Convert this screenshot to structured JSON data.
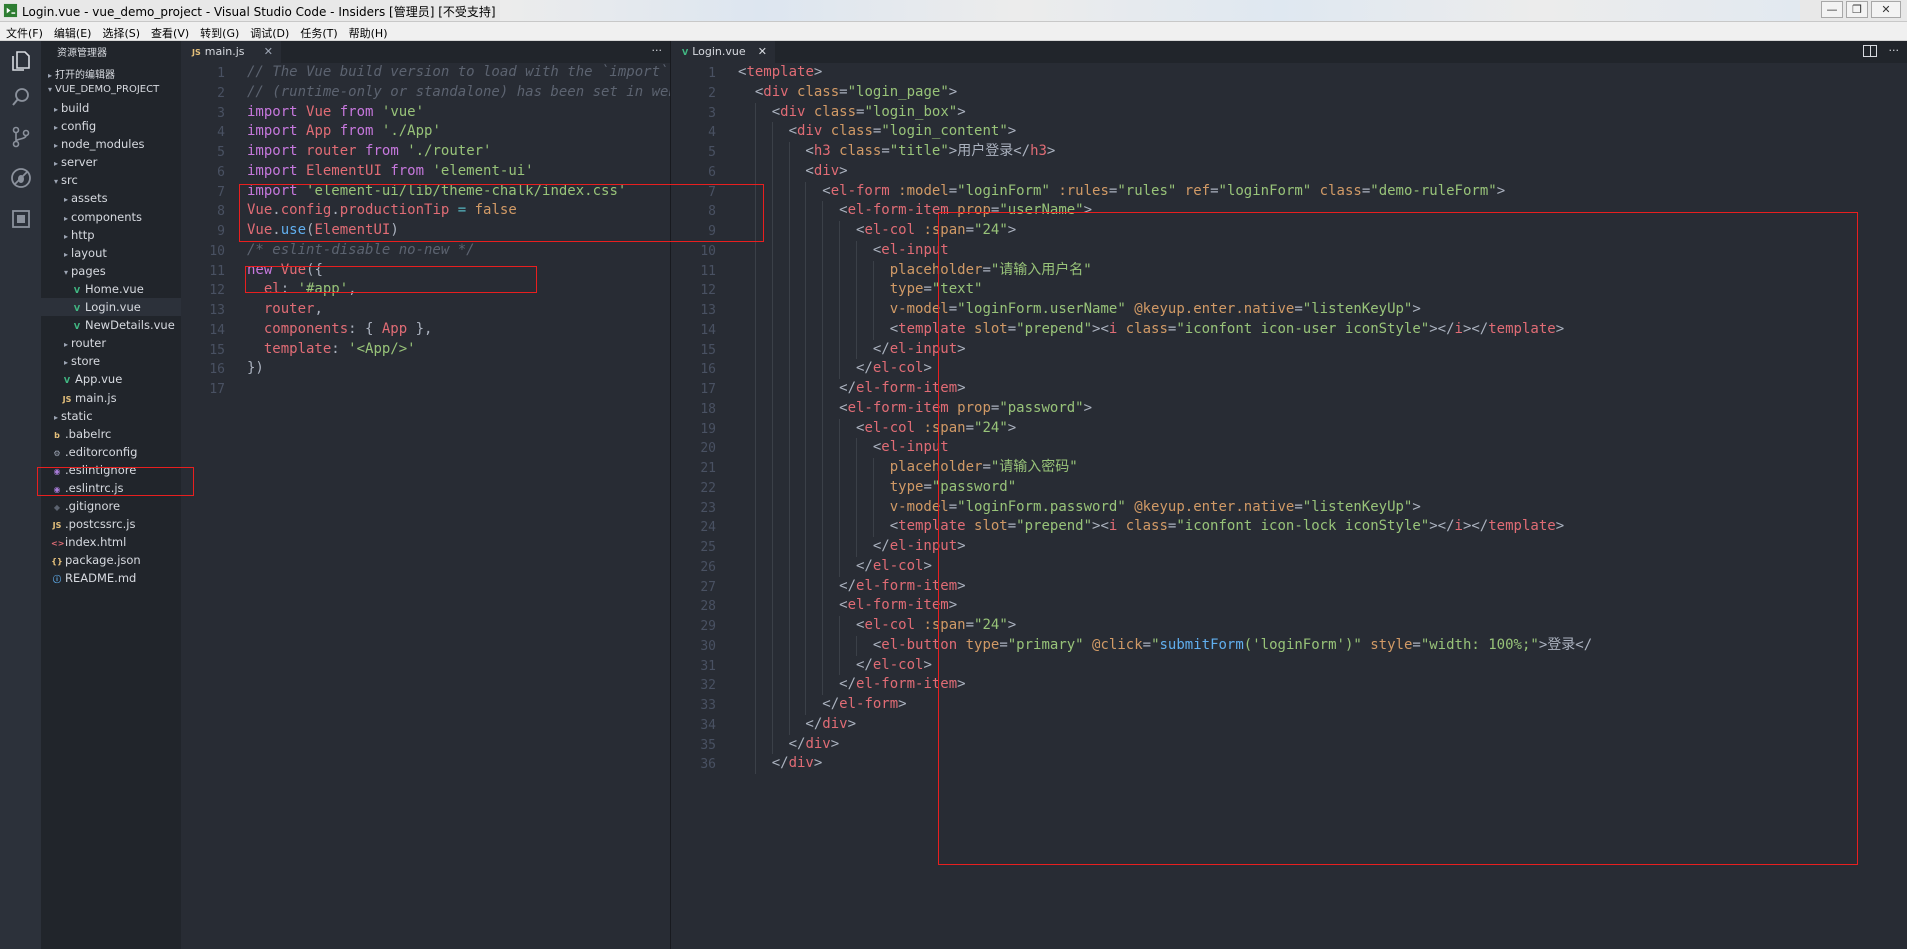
{
  "window": {
    "title": "Login.vue - vue_demo_project - Visual Studio Code - Insiders [管理员] [不受支持]",
    "controls": [
      "—",
      "❐",
      "✕"
    ]
  },
  "menu": [
    "文件(F)",
    "编辑(E)",
    "选择(S)",
    "查看(V)",
    "转到(G)",
    "调试(D)",
    "任务(T)",
    "帮助(H)"
  ],
  "activity_icons": [
    "files-icon",
    "search-icon",
    "source-control-icon",
    "debug-icon",
    "extensions-icon"
  ],
  "explorer": {
    "header": "资源管理器",
    "open_editors": "打开的编辑器",
    "project": "VUE_DEMO_PROJECT",
    "items": [
      {
        "label": "build",
        "depth": 1,
        "arrow": "▸",
        "icon": ""
      },
      {
        "label": "config",
        "depth": 1,
        "arrow": "▸",
        "icon": ""
      },
      {
        "label": "node_modules",
        "depth": 1,
        "arrow": "▸",
        "icon": ""
      },
      {
        "label": "server",
        "depth": 1,
        "arrow": "▸",
        "icon": ""
      },
      {
        "label": "src",
        "depth": 1,
        "arrow": "▾",
        "icon": ""
      },
      {
        "label": "assets",
        "depth": 2,
        "arrow": "▸",
        "icon": ""
      },
      {
        "label": "components",
        "depth": 2,
        "arrow": "▸",
        "icon": ""
      },
      {
        "label": "http",
        "depth": 2,
        "arrow": "▸",
        "icon": ""
      },
      {
        "label": "layout",
        "depth": 2,
        "arrow": "▸",
        "icon": ""
      },
      {
        "label": "pages",
        "depth": 2,
        "arrow": "▾",
        "icon": ""
      },
      {
        "label": "Home.vue",
        "depth": 3,
        "arrow": "",
        "icon": "V"
      },
      {
        "label": "Login.vue",
        "depth": 3,
        "arrow": "",
        "icon": "V",
        "selected": true
      },
      {
        "label": "NewDetails.vue",
        "depth": 3,
        "arrow": "",
        "icon": "V"
      },
      {
        "label": "router",
        "depth": 2,
        "arrow": "▸",
        "icon": ""
      },
      {
        "label": "store",
        "depth": 2,
        "arrow": "▸",
        "icon": ""
      },
      {
        "label": "App.vue",
        "depth": 2,
        "arrow": "",
        "icon": "V"
      },
      {
        "label": "main.js",
        "depth": 2,
        "arrow": "",
        "icon": "JS"
      },
      {
        "label": "static",
        "depth": 1,
        "arrow": "▸",
        "icon": ""
      },
      {
        "label": ".babelrc",
        "depth": 1,
        "arrow": "",
        "icon": "b"
      },
      {
        "label": ".editorconfig",
        "depth": 1,
        "arrow": "",
        "icon": "⚙"
      },
      {
        "label": ".eslintignore",
        "depth": 1,
        "arrow": "",
        "icon": "◉"
      },
      {
        "label": ".eslintrc.js",
        "depth": 1,
        "arrow": "",
        "icon": "◉"
      },
      {
        "label": ".gitignore",
        "depth": 1,
        "arrow": "",
        "icon": "◆"
      },
      {
        "label": ".postcssrc.js",
        "depth": 1,
        "arrow": "",
        "icon": "JS"
      },
      {
        "label": "index.html",
        "depth": 1,
        "arrow": "",
        "icon": "<>"
      },
      {
        "label": "package.json",
        "depth": 1,
        "arrow": "",
        "icon": "{}"
      },
      {
        "label": "README.md",
        "depth": 1,
        "arrow": "",
        "icon": "ⓘ"
      }
    ]
  },
  "left_editor": {
    "tab": {
      "icon": "JS",
      "label": "main.js"
    },
    "more": "···",
    "line_numbers": [
      "1",
      "2",
      "3",
      "4",
      "5",
      "6",
      "7",
      "8",
      "9",
      "10",
      "11",
      "12",
      "13",
      "14",
      "15",
      "16",
      "17"
    ],
    "lines": [
      [
        [
          "c",
          "// The Vue build version to load with the `import` co"
        ]
      ],
      [
        [
          "c",
          "// (runtime-only or standalone) has been set in webpa"
        ]
      ],
      [
        [
          "k",
          "import "
        ],
        [
          "v",
          "Vue "
        ],
        [
          "k",
          "from "
        ],
        [
          "s",
          "'vue'"
        ]
      ],
      [
        [
          "k",
          "import "
        ],
        [
          "v",
          "App "
        ],
        [
          "k",
          "from "
        ],
        [
          "s",
          "'./App'"
        ]
      ],
      [
        [
          "k",
          "import "
        ],
        [
          "v",
          "router "
        ],
        [
          "k",
          "from "
        ],
        [
          "s",
          "'./router'"
        ]
      ],
      [
        [
          "k",
          "import "
        ],
        [
          "v",
          "ElementUI "
        ],
        [
          "k",
          "from "
        ],
        [
          "s",
          "'element-ui'"
        ]
      ],
      [
        [
          "k",
          "import "
        ],
        [
          "s",
          "'element-ui/lib/theme-chalk/index.css'"
        ]
      ],
      [
        [
          "v",
          "Vue"
        ],
        [
          "p",
          "."
        ],
        [
          "v",
          "config"
        ],
        [
          "p",
          "."
        ],
        [
          "v",
          "productionTip "
        ],
        [
          "o",
          "= "
        ],
        [
          "n",
          "false"
        ]
      ],
      [
        [
          "v",
          "Vue"
        ],
        [
          "p",
          "."
        ],
        [
          "f",
          "use"
        ],
        [
          "p",
          "("
        ],
        [
          "v",
          "ElementUI"
        ],
        [
          "p",
          ")"
        ]
      ],
      [
        [
          "c",
          "/* eslint-disable no-new */"
        ]
      ],
      [
        [
          "k",
          "new "
        ],
        [
          "v",
          "Vue"
        ],
        [
          "p",
          "({"
        ]
      ],
      [
        [
          "p",
          "  "
        ],
        [
          "v",
          "el"
        ],
        [
          "p",
          ": "
        ],
        [
          "s",
          "'#app'"
        ],
        [
          "p",
          ","
        ]
      ],
      [
        [
          "p",
          "  "
        ],
        [
          "v",
          "router"
        ],
        [
          "p",
          ","
        ]
      ],
      [
        [
          "p",
          "  "
        ],
        [
          "v",
          "components"
        ],
        [
          "p",
          ": { "
        ],
        [
          "v",
          "App "
        ],
        [
          "p",
          "},"
        ]
      ],
      [
        [
          "p",
          "  "
        ],
        [
          "v",
          "template"
        ],
        [
          "p",
          ": "
        ],
        [
          "s",
          "'<App/>'"
        ]
      ],
      [
        [
          "p",
          "})"
        ]
      ],
      []
    ]
  },
  "right_editor": {
    "tab": {
      "icon": "V",
      "label": "Login.vue"
    },
    "more": "···",
    "line_numbers": [
      "1",
      "2",
      "3",
      "4",
      "5",
      "6",
      "7",
      "8",
      "9",
      "10",
      "11",
      "12",
      "13",
      "14",
      "15",
      "16",
      "17",
      "18",
      "19",
      "20",
      "21",
      "22",
      "23",
      "24",
      "25",
      "26",
      "27",
      "28",
      "29",
      "30",
      "31",
      "32",
      "33",
      "34",
      "35",
      "36"
    ],
    "lines": [
      [
        [
          "p",
          "<"
        ],
        [
          "t",
          "template"
        ],
        [
          "p",
          ">"
        ]
      ],
      [
        [
          "p",
          "  <"
        ],
        [
          "t",
          "div "
        ],
        [
          "a",
          "class"
        ],
        [
          "p",
          "="
        ],
        [
          "s",
          "\"login_page\""
        ],
        [
          "p",
          ">"
        ]
      ],
      [
        [
          "p",
          "    <"
        ],
        [
          "t",
          "div "
        ],
        [
          "a",
          "class"
        ],
        [
          "p",
          "="
        ],
        [
          "s",
          "\"login_box\""
        ],
        [
          "p",
          ">"
        ]
      ],
      [
        [
          "p",
          "      <"
        ],
        [
          "t",
          "div "
        ],
        [
          "a",
          "class"
        ],
        [
          "p",
          "="
        ],
        [
          "s",
          "\"login_content\""
        ],
        [
          "p",
          ">"
        ]
      ],
      [
        [
          "p",
          "        <"
        ],
        [
          "t",
          "h3 "
        ],
        [
          "a",
          "class"
        ],
        [
          "p",
          "="
        ],
        [
          "s",
          "\"title\""
        ],
        [
          "p",
          ">"
        ],
        [
          "pl",
          "用户登录"
        ],
        [
          "p",
          "</"
        ],
        [
          "t",
          "h3"
        ],
        [
          "p",
          ">"
        ]
      ],
      [
        [
          "p",
          "        <"
        ],
        [
          "t",
          "div"
        ],
        [
          "p",
          ">"
        ]
      ],
      [
        [
          "p",
          "          <"
        ],
        [
          "t",
          "el-form "
        ],
        [
          "a",
          ":model"
        ],
        [
          "p",
          "="
        ],
        [
          "s",
          "\"loginForm\" "
        ],
        [
          "a",
          ":rules"
        ],
        [
          "p",
          "="
        ],
        [
          "s",
          "\"rules\" "
        ],
        [
          "a",
          "ref"
        ],
        [
          "p",
          "="
        ],
        [
          "s",
          "\"loginForm\" "
        ],
        [
          "a",
          "class"
        ],
        [
          "p",
          "="
        ],
        [
          "s",
          "\"demo-ruleForm\""
        ],
        [
          "p",
          ">"
        ]
      ],
      [
        [
          "p",
          "            <"
        ],
        [
          "t",
          "el-form-item "
        ],
        [
          "a",
          "prop"
        ],
        [
          "p",
          "="
        ],
        [
          "s",
          "\"userName\""
        ],
        [
          "p",
          ">"
        ]
      ],
      [
        [
          "p",
          "              <"
        ],
        [
          "t",
          "el-col "
        ],
        [
          "a",
          ":span"
        ],
        [
          "p",
          "="
        ],
        [
          "s",
          "\"24\""
        ],
        [
          "p",
          ">"
        ]
      ],
      [
        [
          "p",
          "                <"
        ],
        [
          "t",
          "el-input"
        ]
      ],
      [
        [
          "p",
          "                  "
        ],
        [
          "a",
          "placeholder"
        ],
        [
          "p",
          "="
        ],
        [
          "s",
          "\"请输入用户名\""
        ]
      ],
      [
        [
          "p",
          "                  "
        ],
        [
          "a",
          "type"
        ],
        [
          "p",
          "="
        ],
        [
          "s",
          "\"text\""
        ]
      ],
      [
        [
          "p",
          "                  "
        ],
        [
          "a",
          "v-model"
        ],
        [
          "p",
          "="
        ],
        [
          "s",
          "\"loginForm.userName\" "
        ],
        [
          "a",
          "@keyup.enter.native"
        ],
        [
          "p",
          "="
        ],
        [
          "s",
          "\"listenKeyUp\""
        ],
        [
          "p",
          ">"
        ]
      ],
      [
        [
          "p",
          "                  <"
        ],
        [
          "t",
          "template "
        ],
        [
          "a",
          "slot"
        ],
        [
          "p",
          "="
        ],
        [
          "s",
          "\"prepend\""
        ],
        [
          "p",
          "><"
        ],
        [
          "t",
          "i "
        ],
        [
          "a",
          "class"
        ],
        [
          "p",
          "="
        ],
        [
          "s",
          "\"iconfont icon-user iconStyle\""
        ],
        [
          "p",
          "></"
        ],
        [
          "t",
          "i"
        ],
        [
          "p",
          "></"
        ],
        [
          "t",
          "template"
        ],
        [
          "p",
          ">"
        ]
      ],
      [
        [
          "p",
          "                </"
        ],
        [
          "t",
          "el-input"
        ],
        [
          "p",
          ">"
        ]
      ],
      [
        [
          "p",
          "              </"
        ],
        [
          "t",
          "el-col"
        ],
        [
          "p",
          ">"
        ]
      ],
      [
        [
          "p",
          "            </"
        ],
        [
          "t",
          "el-form-item"
        ],
        [
          "p",
          ">"
        ]
      ],
      [
        [
          "p",
          "            <"
        ],
        [
          "t",
          "el-form-item "
        ],
        [
          "a",
          "prop"
        ],
        [
          "p",
          "="
        ],
        [
          "s",
          "\"password\""
        ],
        [
          "p",
          ">"
        ]
      ],
      [
        [
          "p",
          "              <"
        ],
        [
          "t",
          "el-col "
        ],
        [
          "a",
          ":span"
        ],
        [
          "p",
          "="
        ],
        [
          "s",
          "\"24\""
        ],
        [
          "p",
          ">"
        ]
      ],
      [
        [
          "p",
          "                <"
        ],
        [
          "t",
          "el-input"
        ]
      ],
      [
        [
          "p",
          "                  "
        ],
        [
          "a",
          "placeholder"
        ],
        [
          "p",
          "="
        ],
        [
          "s",
          "\"请输入密码\""
        ]
      ],
      [
        [
          "p",
          "                  "
        ],
        [
          "a",
          "type"
        ],
        [
          "p",
          "="
        ],
        [
          "s",
          "\"password\""
        ]
      ],
      [
        [
          "p",
          "                  "
        ],
        [
          "a",
          "v-model"
        ],
        [
          "p",
          "="
        ],
        [
          "s",
          "\"loginForm.password\" "
        ],
        [
          "a",
          "@keyup.enter.native"
        ],
        [
          "p",
          "="
        ],
        [
          "s",
          "\"listenKeyUp\""
        ],
        [
          "p",
          ">"
        ]
      ],
      [
        [
          "p",
          "                  <"
        ],
        [
          "t",
          "template "
        ],
        [
          "a",
          "slot"
        ],
        [
          "p",
          "="
        ],
        [
          "s",
          "\"prepend\""
        ],
        [
          "p",
          "><"
        ],
        [
          "t",
          "i "
        ],
        [
          "a",
          "class"
        ],
        [
          "p",
          "="
        ],
        [
          "s",
          "\"iconfont icon-lock iconStyle\""
        ],
        [
          "p",
          "></"
        ],
        [
          "t",
          "i"
        ],
        [
          "p",
          "></"
        ],
        [
          "t",
          "template"
        ],
        [
          "p",
          ">"
        ]
      ],
      [
        [
          "p",
          "                </"
        ],
        [
          "t",
          "el-input"
        ],
        [
          "p",
          ">"
        ]
      ],
      [
        [
          "p",
          "              </"
        ],
        [
          "t",
          "el-col"
        ],
        [
          "p",
          ">"
        ]
      ],
      [
        [
          "p",
          "            </"
        ],
        [
          "t",
          "el-form-item"
        ],
        [
          "p",
          ">"
        ]
      ],
      [
        [
          "p",
          "            <"
        ],
        [
          "t",
          "el-form-item"
        ],
        [
          "p",
          ">"
        ]
      ],
      [
        [
          "p",
          "              <"
        ],
        [
          "t",
          "el-col "
        ],
        [
          "a",
          ":span"
        ],
        [
          "p",
          "="
        ],
        [
          "s",
          "\"24\""
        ],
        [
          "p",
          ">"
        ]
      ],
      [
        [
          "p",
          "                <"
        ],
        [
          "t",
          "el-button "
        ],
        [
          "a",
          "type"
        ],
        [
          "p",
          "="
        ],
        [
          "s",
          "\"primary\" "
        ],
        [
          "a",
          "@click"
        ],
        [
          "p",
          "="
        ],
        [
          "s",
          "\""
        ],
        [
          "f",
          "submitForm"
        ],
        [
          "s",
          "('loginForm')\" "
        ],
        [
          "a",
          "style"
        ],
        [
          "p",
          "="
        ],
        [
          "s",
          "\"width: 100%;\""
        ],
        [
          "p",
          ">"
        ],
        [
          "pl",
          "登录</"
        ]
      ],
      [
        [
          "p",
          "              </"
        ],
        [
          "t",
          "el-col"
        ],
        [
          "p",
          ">"
        ]
      ],
      [
        [
          "p",
          "            </"
        ],
        [
          "t",
          "el-form-item"
        ],
        [
          "p",
          ">"
        ]
      ],
      [
        [
          "p",
          "          </"
        ],
        [
          "t",
          "el-form"
        ],
        [
          "p",
          ">"
        ]
      ],
      [
        [
          "p",
          "        </"
        ],
        [
          "t",
          "div"
        ],
        [
          "p",
          ">"
        ]
      ],
      [
        [
          "p",
          "      </"
        ],
        [
          "t",
          "div"
        ],
        [
          "p",
          ">"
        ]
      ],
      [
        [
          "p",
          "    </"
        ],
        [
          "t",
          "div"
        ],
        [
          "p",
          ">"
        ]
      ]
    ]
  },
  "colors": {
    "editor_bg": "#282c34",
    "sidebar_bg": "#21252b",
    "highlight_box": "#e81f1f",
    "vue_icon": "#41b883",
    "js_icon": "#e5c07b"
  }
}
